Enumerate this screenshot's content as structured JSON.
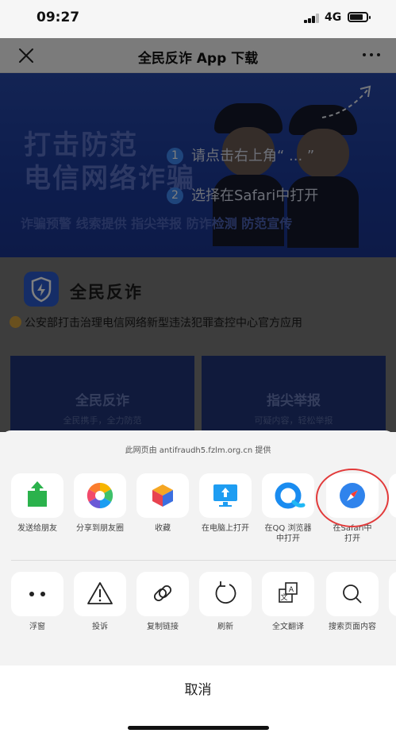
{
  "status_bar": {
    "time": "09:27",
    "network": "4G"
  },
  "nav": {
    "title": "全民反诈 App 下载"
  },
  "banner": {
    "headline_1": "打击防范",
    "headline_2": "电信网络诈骗",
    "slogan": "诈骗预警  线索提供  指尖举报  防诈检测  防范宣传",
    "step_1_num": "1",
    "step_1": "请点击右上角“ ... ”",
    "step_2_num": "2",
    "step_2": "选择在Safari中打开"
  },
  "app_info": {
    "name": "全民反诈",
    "description": "公安部打击治理电信网络新型违法犯罪查控中心官方应用"
  },
  "cards": [
    {
      "title": "全民反诈",
      "subtitle": "全民携手，全力防范"
    },
    {
      "title": "指尖举报",
      "subtitle": "可疑内容，轻松举报"
    }
  ],
  "share_sheet": {
    "provider": "此网页由 antifraudh5.fzlm.org.cn 提供",
    "row1": [
      {
        "label": "发送给朋友",
        "icon": "share-friend-icon"
      },
      {
        "label": "分享到朋友圈",
        "icon": "moments-icon"
      },
      {
        "label": "收藏",
        "icon": "favorite-cube-icon"
      },
      {
        "label": "在电脑上打开",
        "icon": "computer-icon"
      },
      {
        "label": "在QQ 浏览器\n中打开",
        "icon": "qq-browser-icon"
      },
      {
        "label": "在Safari中\n打开",
        "icon": "safari-icon"
      }
    ],
    "row2": [
      {
        "label": "浮窗",
        "icon": "float-window-icon"
      },
      {
        "label": "投诉",
        "icon": "warning-icon"
      },
      {
        "label": "复制链接",
        "icon": "link-icon"
      },
      {
        "label": "刷新",
        "icon": "refresh-icon"
      },
      {
        "label": "全文翻译",
        "icon": "translate-icon"
      },
      {
        "label": "搜索页面内容",
        "icon": "search-icon"
      }
    ],
    "cancel": "取消"
  },
  "colors": {
    "accent": "#3f8bf7",
    "highlight": "#e23a3a",
    "banner": "#1b3a9a"
  }
}
